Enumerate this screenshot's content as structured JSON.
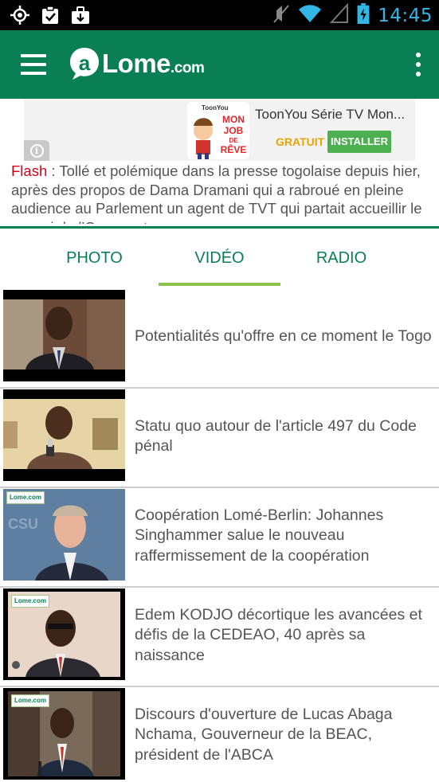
{
  "status_bar": {
    "time": "14:45",
    "icons": [
      "gps-icon",
      "clipboard-check-icon",
      "briefcase-icon",
      "mute-icon",
      "wifi-icon",
      "signal-icon",
      "battery-charging-icon"
    ]
  },
  "app_bar": {
    "logo_text": "Lome",
    "logo_suffix": ".com",
    "icons": [
      "hamburger-menu-icon",
      "more-vert-icon"
    ]
  },
  "ad": {
    "app_brand": "ToonYou",
    "title": "ToonYou Série TV Mon...",
    "price": "GRATUIT",
    "install_label": "INSTALLER",
    "info_icon": "i",
    "icon_text": [
      "MON",
      "JOB",
      "DE",
      "RÊVE"
    ]
  },
  "flash": {
    "label": "Flash",
    "separator": " : ",
    "text": "Tollé et polémique dans la presse togolaise depuis hier, après des propos de Dama Dramani qui a rabroué en pleine audience au Parlement un agent de TVT qui partait accueillir le convoi de l'Occupant..."
  },
  "tabs": {
    "items": [
      {
        "label": "PHOTO"
      },
      {
        "label": "VIDÉO"
      },
      {
        "label": "RADIO"
      }
    ],
    "active": "VIDÉO",
    "accent_color": "#8bc34a"
  },
  "videos": [
    {
      "title": "Potentialités qu'offre en ce moment le Togo"
    },
    {
      "title": "Statu quo autour de l'article 497 du Code pénal"
    },
    {
      "title": "Coopération Lomé-Berlin: Johannes Singhammer salue le nouveau raffermissement de la coopération",
      "badge": "Lome.com"
    },
    {
      "title": "Edem KODJO décortique les avancées et défis de la CEDEAO, 40 après sa naissance",
      "badge": "Lome.com"
    },
    {
      "title": "Discours d'ouverture de Lucas Abaga Nchama, Gouverneur de la BEAC, président de l'ABCA",
      "badge": "Lome.com"
    }
  ],
  "colors": {
    "brand_green": "#0a7f53",
    "flash_red": "#d0021b",
    "status_time": "#33b5e5"
  }
}
